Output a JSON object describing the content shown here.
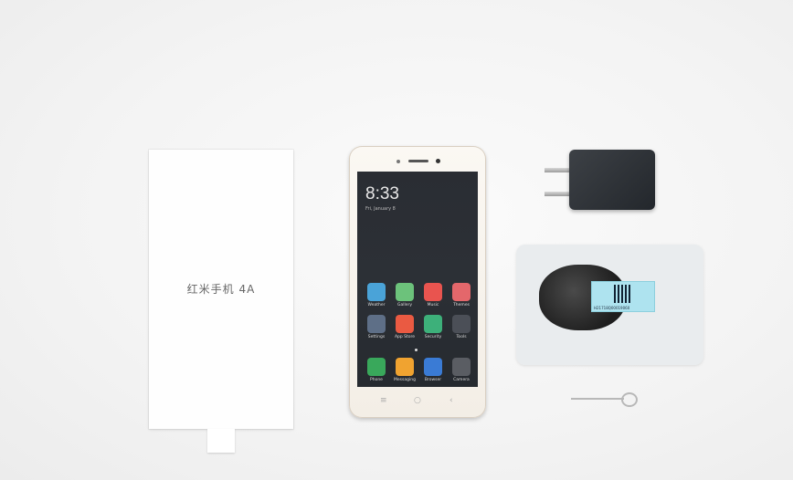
{
  "booklet": {
    "title": "红米手机 4A"
  },
  "phone": {
    "clock": "8:33",
    "date": "Fri, January 8",
    "apps": [
      {
        "label": "Weather",
        "color": "#4aa3d8"
      },
      {
        "label": "Gallery",
        "color": "#6cc27b"
      },
      {
        "label": "Music",
        "color": "#e9544f"
      },
      {
        "label": "Themes",
        "color": "#e4676b"
      },
      {
        "label": "Settings",
        "color": "#5e6f87"
      },
      {
        "label": "App Store",
        "color": "#ea5a42"
      },
      {
        "label": "Security",
        "color": "#3db07a"
      },
      {
        "label": "Tools",
        "color": "#4b4f57"
      },
      {
        "label": "Phone",
        "color": "#39a85b"
      },
      {
        "label": "Messaging",
        "color": "#f0a330"
      },
      {
        "label": "Browser",
        "color": "#3a7bd5"
      },
      {
        "label": "Camera",
        "color": "#5a5d63"
      }
    ],
    "nav_keys": [
      "≡",
      "○",
      "‹"
    ]
  },
  "earphones": {
    "sticker_code": "H21718Q00019060"
  }
}
